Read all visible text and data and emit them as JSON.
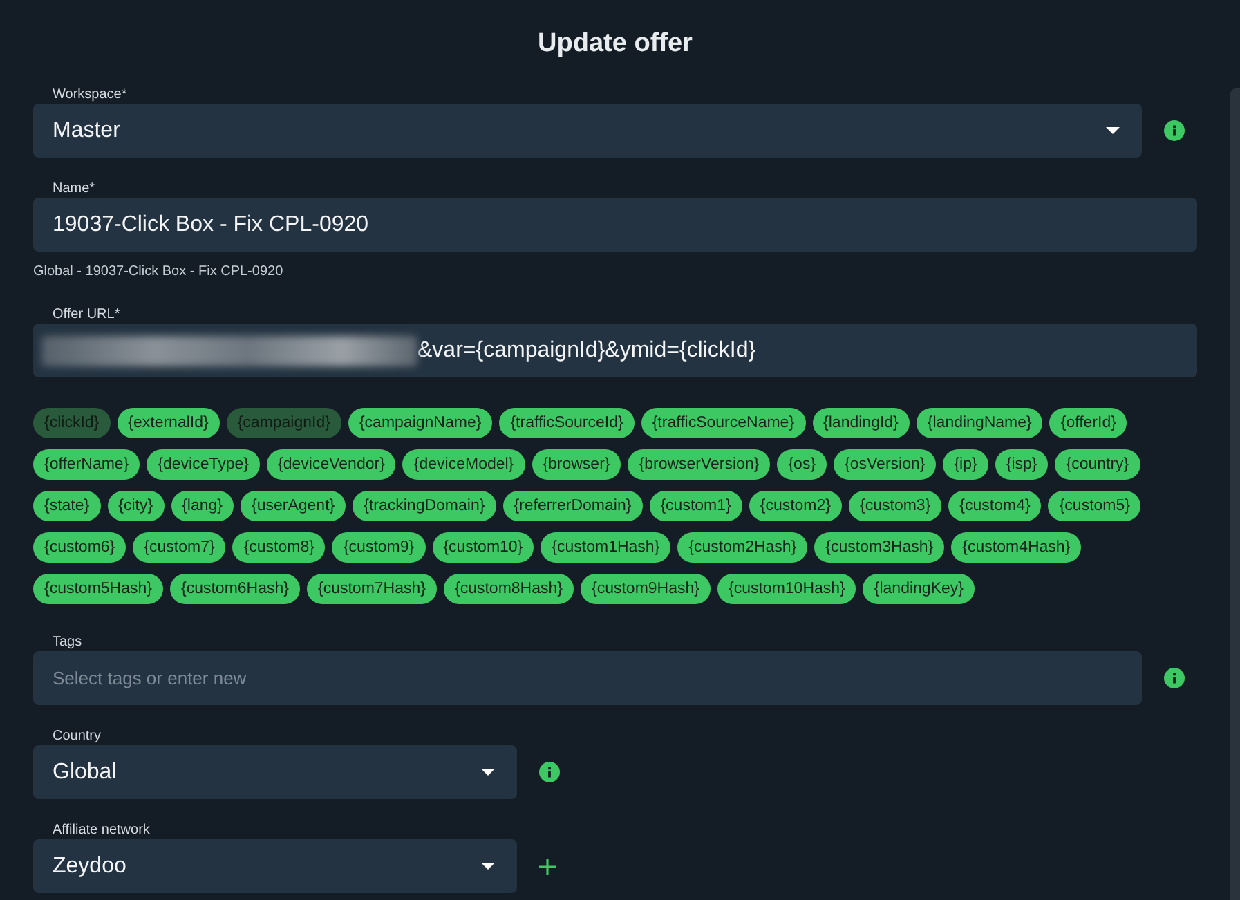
{
  "title": "Update offer",
  "workspace": {
    "label": "Workspace*",
    "value": "Master",
    "info": true
  },
  "name": {
    "label": "Name*",
    "value": "19037-Click Box - Fix CPL-0920",
    "hint": "Global - 19037-Click Box - Fix CPL-0920"
  },
  "offer_url": {
    "label": "Offer URL*",
    "redacted": true,
    "value": "&var={campaignId}&ymid={clickId}"
  },
  "tokens": [
    {
      "label": "{clickId}",
      "used": true
    },
    {
      "label": "{externalId}",
      "used": false
    },
    {
      "label": "{campaignId}",
      "used": true
    },
    {
      "label": "{campaignName}",
      "used": false
    },
    {
      "label": "{trafficSourceId}",
      "used": false
    },
    {
      "label": "{trafficSourceName}",
      "used": false
    },
    {
      "label": "{landingId}",
      "used": false
    },
    {
      "label": "{landingName}",
      "used": false
    },
    {
      "label": "{offerId}",
      "used": false
    },
    {
      "label": "{offerName}",
      "used": false
    },
    {
      "label": "{deviceType}",
      "used": false
    },
    {
      "label": "{deviceVendor}",
      "used": false
    },
    {
      "label": "{deviceModel}",
      "used": false
    },
    {
      "label": "{browser}",
      "used": false
    },
    {
      "label": "{browserVersion}",
      "used": false
    },
    {
      "label": "{os}",
      "used": false
    },
    {
      "label": "{osVersion}",
      "used": false
    },
    {
      "label": "{ip}",
      "used": false
    },
    {
      "label": "{isp}",
      "used": false
    },
    {
      "label": "{country}",
      "used": false
    },
    {
      "label": "{state}",
      "used": false
    },
    {
      "label": "{city}",
      "used": false
    },
    {
      "label": "{lang}",
      "used": false
    },
    {
      "label": "{userAgent}",
      "used": false
    },
    {
      "label": "{trackingDomain}",
      "used": false
    },
    {
      "label": "{referrerDomain}",
      "used": false
    },
    {
      "label": "{custom1}",
      "used": false
    },
    {
      "label": "{custom2}",
      "used": false
    },
    {
      "label": "{custom3}",
      "used": false
    },
    {
      "label": "{custom4}",
      "used": false
    },
    {
      "label": "{custom5}",
      "used": false
    },
    {
      "label": "{custom6}",
      "used": false
    },
    {
      "label": "{custom7}",
      "used": false
    },
    {
      "label": "{custom8}",
      "used": false
    },
    {
      "label": "{custom9}",
      "used": false
    },
    {
      "label": "{custom10}",
      "used": false
    },
    {
      "label": "{custom1Hash}",
      "used": false
    },
    {
      "label": "{custom2Hash}",
      "used": false
    },
    {
      "label": "{custom3Hash}",
      "used": false
    },
    {
      "label": "{custom4Hash}",
      "used": false
    },
    {
      "label": "{custom5Hash}",
      "used": false
    },
    {
      "label": "{custom6Hash}",
      "used": false
    },
    {
      "label": "{custom7Hash}",
      "used": false
    },
    {
      "label": "{custom8Hash}",
      "used": false
    },
    {
      "label": "{custom9Hash}",
      "used": false
    },
    {
      "label": "{custom10Hash}",
      "used": false
    },
    {
      "label": "{landingKey}",
      "used": false
    }
  ],
  "tags": {
    "label": "Tags",
    "placeholder": "Select tags or enter new",
    "info": true
  },
  "country": {
    "label": "Country",
    "value": "Global",
    "info": true
  },
  "affiliate_network": {
    "label": "Affiliate network",
    "value": "Zeydoo",
    "add": true
  }
}
